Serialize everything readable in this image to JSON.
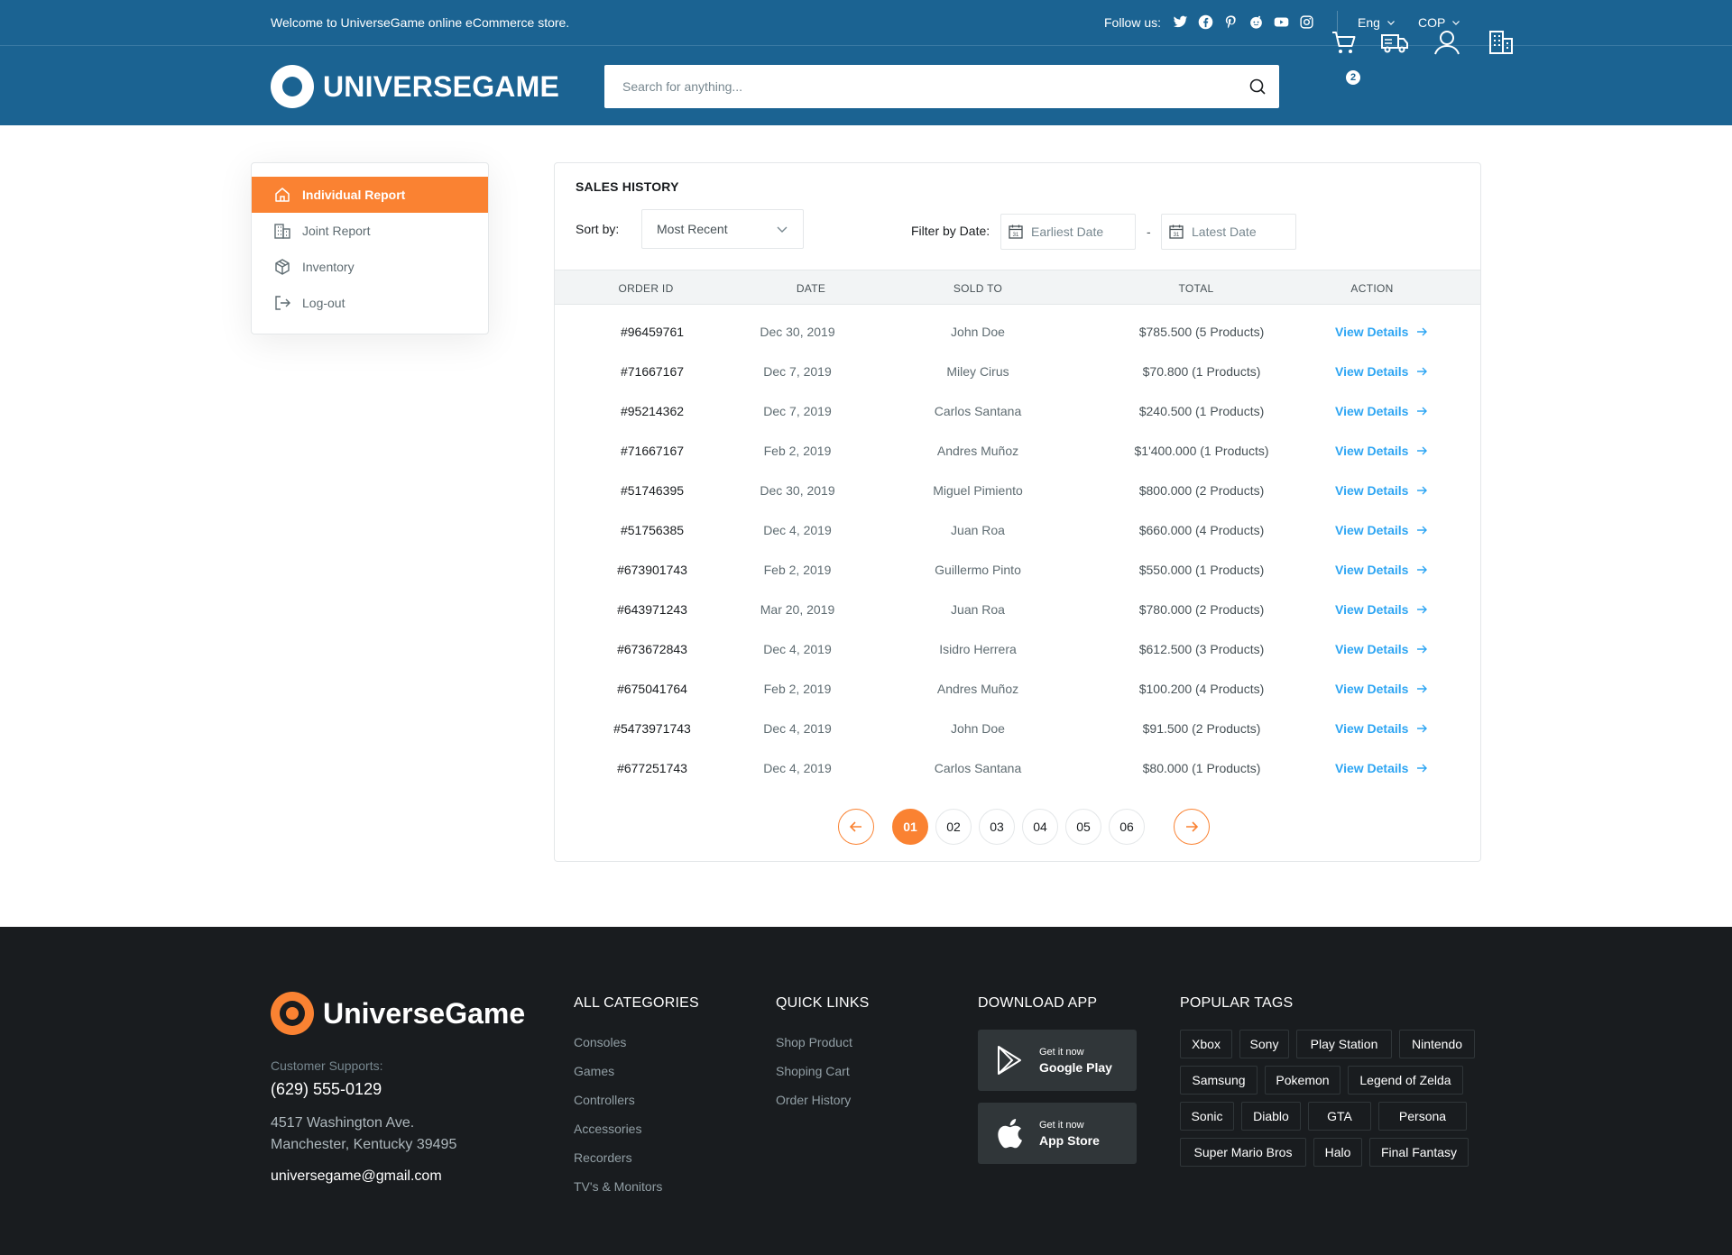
{
  "topbar": {
    "welcome": "Welcome to UniverseGame online eCommerce store.",
    "follow_label": "Follow us:",
    "socials": [
      "twitter-icon",
      "facebook-icon",
      "pinterest-icon",
      "reddit-icon",
      "youtube-icon",
      "instagram-icon"
    ],
    "language": "Eng",
    "currency": "COP"
  },
  "header": {
    "brand": "UNIVERSEGAME",
    "search_placeholder": "Search for anything...",
    "cart_count": "2",
    "icons": [
      "cart-icon",
      "truck-icon",
      "user-icon",
      "building-icon"
    ]
  },
  "sidebar": {
    "items": [
      {
        "label": "Individual Report",
        "icon": "home-icon",
        "active": true
      },
      {
        "label": "Joint Report",
        "icon": "building-icon",
        "active": false
      },
      {
        "label": "Inventory",
        "icon": "package-icon",
        "active": false
      },
      {
        "label": "Log-out",
        "icon": "logout-icon",
        "active": false
      }
    ]
  },
  "sales": {
    "title": "SALES HISTORY",
    "sort_label": "Sort by:",
    "sort_value": "Most Recent",
    "filter_label": "Filter by Date:",
    "earliest_placeholder": "Earliest Date",
    "latest_placeholder": "Latest Date",
    "date_separator": "-",
    "columns": [
      "ORDER ID",
      "DATE",
      "SOLD TO",
      "TOTAL",
      "ACTION"
    ],
    "action_label": "View Details",
    "rows": [
      {
        "id": "#96459761",
        "date": "Dec 30, 2019",
        "sold_to": "John Doe",
        "total": "$785.500 (5 Products)"
      },
      {
        "id": "#71667167",
        "date": "Dec 7, 2019",
        "sold_to": "Miley Cirus",
        "total": "$70.800 (1 Products)"
      },
      {
        "id": "#95214362",
        "date": "Dec 7, 2019",
        "sold_to": "Carlos Santana",
        "total": "$240.500 (1 Products)"
      },
      {
        "id": "#71667167",
        "date": "Feb 2, 2019",
        "sold_to": "Andres Muñoz",
        "total": "$1'400.000 (1 Products)"
      },
      {
        "id": "#51746395",
        "date": "Dec 30, 2019",
        "sold_to": "Miguel Pimiento",
        "total": "$800.000 (2 Products)"
      },
      {
        "id": "#51756385",
        "date": "Dec 4, 2019",
        "sold_to": "Juan Roa",
        "total": "$660.000 (4 Products)"
      },
      {
        "id": "#673901743",
        "date": "Feb 2, 2019",
        "sold_to": "Guillermo Pinto",
        "total": "$550.000 (1 Products)"
      },
      {
        "id": "#643971243",
        "date": "Mar 20, 2019",
        "sold_to": "Juan Roa",
        "total": "$780.000 (2 Products)"
      },
      {
        "id": "#673672843",
        "date": "Dec 4, 2019",
        "sold_to": "Isidro Herrera",
        "total": "$612.500 (3 Products)"
      },
      {
        "id": "#675041764",
        "date": "Feb 2, 2019",
        "sold_to": "Andres Muñoz",
        "total": "$100.200 (4 Products)"
      },
      {
        "id": "#5473971743",
        "date": "Dec 4, 2019",
        "sold_to": "John Doe",
        "total": "$91.500 (2 Products)"
      },
      {
        "id": "#677251743",
        "date": "Dec 4, 2019",
        "sold_to": "Carlos Santana",
        "total": "$80.000 (1 Products)"
      }
    ],
    "pages": [
      "01",
      "02",
      "03",
      "04",
      "05",
      "06"
    ],
    "current_page": "01"
  },
  "footer": {
    "brand": "UniverseGame",
    "support_label": "Customer Supports:",
    "phone": "(629) 555-0129",
    "address_line1": "4517 Washington Ave.",
    "address_line2": "Manchester, Kentucky 39495",
    "email": "universegame@gmail.com",
    "categories_title": "ALL CATEGORIES",
    "categories": [
      "Consoles",
      "Games",
      "Controllers",
      "Accessories",
      "Recorders",
      "TV's & Monitors"
    ],
    "quick_title": "QUICK LINKS",
    "quick_links": [
      "Shop Product",
      "Shoping Cart",
      "Order History"
    ],
    "download_title": "DOWNLOAD APP",
    "apps": [
      {
        "small": "Get it now",
        "big": "Google Play",
        "icon": "google-play-icon"
      },
      {
        "small": "Get it now",
        "big": "App Store",
        "icon": "apple-icon"
      }
    ],
    "tags_title": "POPULAR TAGS",
    "tags": [
      "Xbox",
      "Sony",
      "Play Station",
      "Nintendo",
      "Samsung",
      "Pokemon",
      "Legend of Zelda",
      "Sonic",
      "Diablo",
      "GTA",
      "Persona",
      "Super Mario Bros",
      "Halo",
      "Final Fantasy"
    ]
  },
  "colors": {
    "primary": "#1b6392",
    "accent": "#fa8232",
    "link": "#2da5f3",
    "footer_bg": "#191c1f"
  }
}
